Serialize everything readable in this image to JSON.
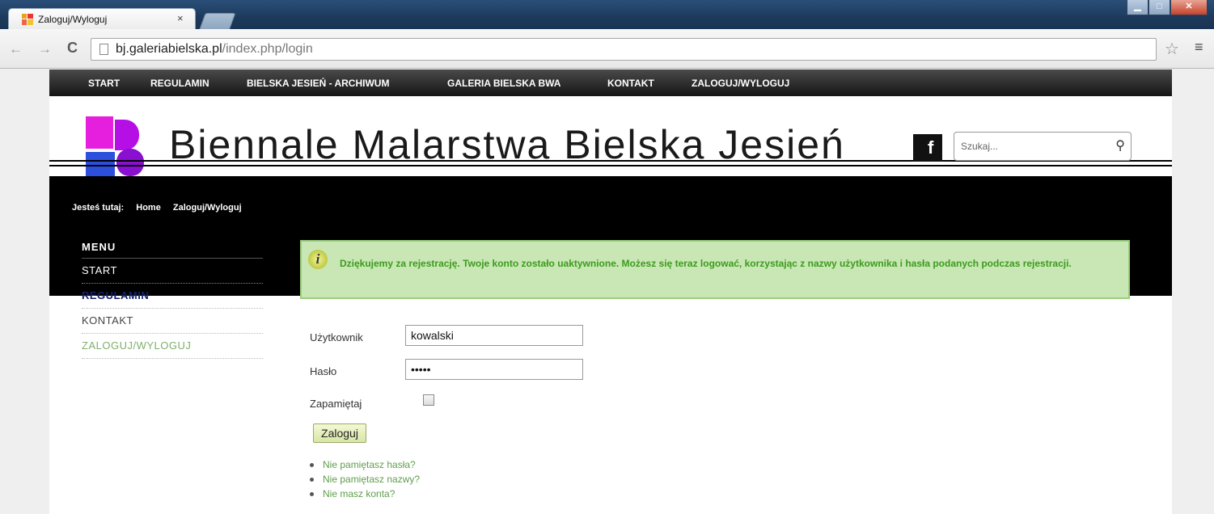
{
  "browser": {
    "tab_title": "Zaloguj/Wyloguj",
    "tab_close": "×",
    "url_host": "bj.galeriabielska.pl",
    "url_path": "/index.php/login"
  },
  "topnav": [
    "START",
    "REGULAMIN",
    "BIELSKA JESIEŃ - ARCHIWUM",
    "GALERIA BIELSKA BWA",
    "KONTAKT",
    "ZALOGUJ/WYLOGUJ"
  ],
  "site_title": "Biennale Malarstwa Bielska Jesień",
  "search": {
    "placeholder": "Szukaj..."
  },
  "breadcrumb": {
    "prefix": "Jesteś tutaj:",
    "home": "Home",
    "current": "Zaloguj/Wyloguj"
  },
  "sidemenu": {
    "heading": "MENU",
    "items": [
      "START",
      "REGULAMIN",
      "KONTAKT",
      "ZALOGUJ/WYLOGUJ"
    ]
  },
  "notice": "Dziękujemy za rejestrację. Twoje konto zostało uaktywnione. Możesz się teraz logować, korzystając z nazwy użytkownika i hasła podanych podczas rejestracji.",
  "form": {
    "username_label": "Użytkownik",
    "username_value": "kowalski",
    "password_label": "Hasło",
    "password_value": "•••••",
    "remember_label": "Zapamiętaj",
    "submit_label": "Zaloguj"
  },
  "links": [
    "Nie pamiętasz hasła?",
    "Nie pamiętasz nazwy?",
    "Nie masz konta?"
  ]
}
